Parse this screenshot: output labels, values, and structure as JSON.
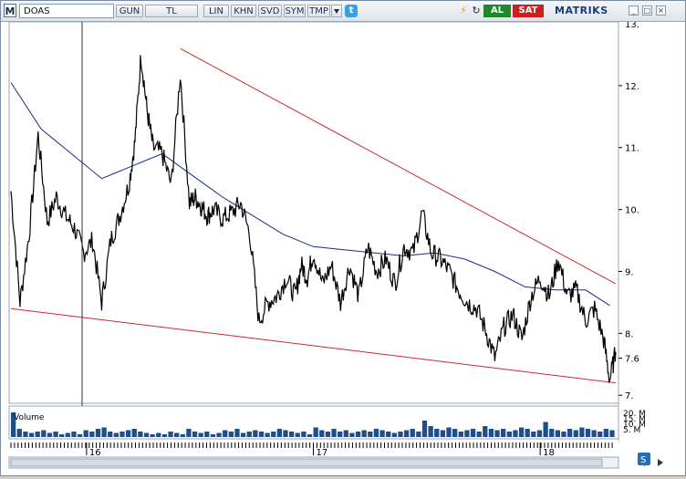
{
  "toolbar": {
    "logo": "M",
    "symbol": "DOAS",
    "buttons": [
      "GUN",
      "TL",
      "LIN",
      "KHN",
      "SVD",
      "SYM",
      "TMP"
    ],
    "buy_label": "AL",
    "sell_label": "SAT",
    "brand": "MATRIKS"
  },
  "icons": {
    "twitter": "twitter-icon",
    "lightning": "lightning-icon",
    "fork": "fork-icon",
    "refresh": "refresh-icon",
    "window_minimize": "window-minimize-icon",
    "window_maximize": "window-maximize-icon",
    "window_close": "window-close-icon"
  },
  "colors": {
    "price_line": "#000000",
    "moving_average": "#1c2a8a",
    "trendline": "#cc2a2a",
    "volume": "#1f4f8a",
    "buy": "#1f8a2b",
    "sell": "#cc1f1f"
  },
  "chart_data": {
    "type": "line",
    "symbol": "DOAS",
    "y_axis": {
      "ticks": [
        "12.",
        "11.",
        "10.",
        "9.",
        "8.",
        "7.6",
        "7."
      ],
      "tick_values": [
        12,
        11,
        10,
        9,
        8,
        7.6,
        7
      ],
      "top_partial_label": "13.",
      "ylim": [
        6.9,
        13.0
      ]
    },
    "x_axis": {
      "tick_labels": [
        "16",
        "17",
        "18"
      ],
      "tick_positions": [
        0.125,
        0.5,
        0.875
      ]
    },
    "series": [
      {
        "name": "",
        "kind": "price",
        "x": [
          0.0,
          0.015,
          0.03,
          0.045,
          0.06,
          0.075,
          0.09,
          0.105,
          0.12,
          0.135,
          0.15,
          0.165,
          0.18,
          0.195,
          0.205,
          0.215,
          0.225,
          0.235,
          0.25,
          0.265,
          0.28,
          0.295,
          0.305,
          0.315,
          0.325,
          0.335,
          0.35,
          0.365,
          0.38,
          0.395,
          0.41,
          0.425,
          0.44,
          0.455,
          0.47,
          0.48,
          0.49,
          0.5,
          0.515,
          0.53,
          0.545,
          0.56,
          0.575,
          0.59,
          0.605,
          0.62,
          0.635,
          0.65,
          0.665,
          0.68,
          0.695,
          0.71,
          0.725,
          0.74,
          0.755,
          0.77,
          0.785,
          0.8,
          0.815,
          0.83,
          0.845,
          0.86,
          0.875,
          0.89,
          0.905,
          0.92,
          0.935,
          0.95,
          0.965,
          0.98,
          0.99,
          1.0
        ],
        "values": [
          10.3,
          8.5,
          9.6,
          11.2,
          9.8,
          10.2,
          9.9,
          9.7,
          9.3,
          9.5,
          8.5,
          9.5,
          9.9,
          10.4,
          11.1,
          12.5,
          11.6,
          11.0,
          10.9,
          10.4,
          12.2,
          10.1,
          10.2,
          10.05,
          9.9,
          10.0,
          9.85,
          9.95,
          10.1,
          9.6,
          8.2,
          8.5,
          8.6,
          8.9,
          8.6,
          9.1,
          8.9,
          9.3,
          8.8,
          9.1,
          8.5,
          9.1,
          8.6,
          9.4,
          9.0,
          9.2,
          8.8,
          9.4,
          9.3,
          9.95,
          9.3,
          9.2,
          9.0,
          8.7,
          8.5,
          8.4,
          8.05,
          7.6,
          8.1,
          8.3,
          7.9,
          8.6,
          8.9,
          8.6,
          9.2,
          8.6,
          8.7,
          8.2,
          8.4,
          7.9,
          7.25,
          7.7
        ]
      },
      {
        "name": "",
        "kind": "moving_average",
        "x": [
          0.0,
          0.05,
          0.1,
          0.15,
          0.2,
          0.25,
          0.3,
          0.35,
          0.4,
          0.45,
          0.5,
          0.55,
          0.6,
          0.65,
          0.7,
          0.75,
          0.8,
          0.85,
          0.9,
          0.95,
          0.99
        ],
        "values": [
          12.05,
          11.3,
          10.9,
          10.5,
          10.7,
          10.9,
          10.55,
          10.2,
          9.9,
          9.6,
          9.4,
          9.35,
          9.3,
          9.25,
          9.3,
          9.2,
          9.0,
          8.75,
          8.7,
          8.7,
          8.45
        ]
      }
    ],
    "trendlines": [
      {
        "name": "",
        "x": [
          0.28,
          1.0
        ],
        "values": [
          12.6,
          8.8
        ]
      },
      {
        "name": "",
        "x": [
          0.0,
          1.0
        ],
        "values": [
          8.4,
          7.2
        ]
      }
    ],
    "volume": {
      "label": "Volume",
      "axis_labels": [
        "20. M",
        "15. M",
        "10. M",
        "5. M"
      ],
      "values": [
        0.9,
        0.3,
        0.2,
        0.15,
        0.2,
        0.25,
        0.15,
        0.2,
        0.1,
        0.15,
        0.2,
        0.1,
        0.25,
        0.2,
        0.3,
        0.35,
        0.2,
        0.15,
        0.2,
        0.25,
        0.3,
        0.2,
        0.15,
        0.1,
        0.15,
        0.1,
        0.2,
        0.15,
        0.1,
        0.3,
        0.2,
        0.15,
        0.2,
        0.1,
        0.15,
        0.25,
        0.2,
        0.3,
        0.15,
        0.2,
        0.25,
        0.2,
        0.15,
        0.2,
        0.3,
        0.25,
        0.2,
        0.15,
        0.2,
        0.1,
        0.35,
        0.25,
        0.2,
        0.3,
        0.2,
        0.25,
        0.15,
        0.2,
        0.25,
        0.2,
        0.3,
        0.25,
        0.2,
        0.15,
        0.2,
        0.25,
        0.3,
        0.2,
        0.6,
        0.4,
        0.3,
        0.25,
        0.35,
        0.3,
        0.2,
        0.25,
        0.3,
        0.2,
        0.4,
        0.3,
        0.25,
        0.3,
        0.2,
        0.25,
        0.35,
        0.3,
        0.2,
        0.25,
        0.55,
        0.3,
        0.25,
        0.2,
        0.3,
        0.25,
        0.35,
        0.3,
        0.25,
        0.2,
        0.3,
        0.25
      ]
    },
    "grid": false,
    "legend": "none"
  }
}
